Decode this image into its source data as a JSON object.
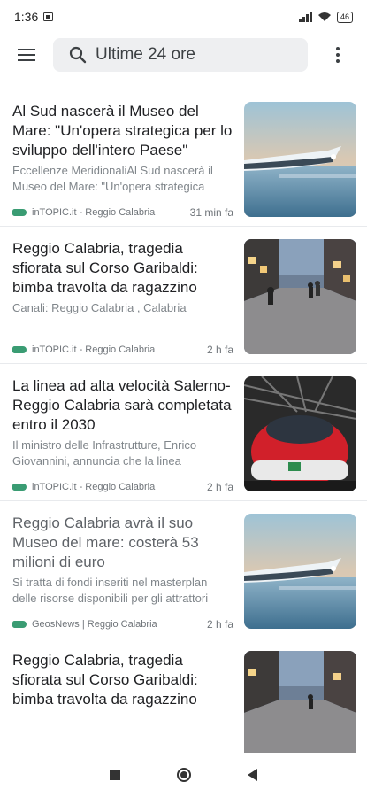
{
  "status": {
    "time": "1:36",
    "battery": "46",
    "sim_icon": "sim-card-icon",
    "signal_icon": "signal-icon",
    "wifi_icon": "wifi-icon"
  },
  "header": {
    "search_text": "Ultime 24 ore",
    "search_icon": "search-icon",
    "menu_icon": "hamburger-menu-icon",
    "more_icon": "more-vert-icon"
  },
  "articles": [
    {
      "title": "Al Sud nascerà il Museo del Mare: \"Un'opera strategica per lo sviluppo dell'intero Paese\"",
      "snippet": "Eccellenze MeridionaliAl Sud nascerà il Museo del Mare: \"Un'opera strategica",
      "source": "inTOPIC.it - Reggio Calabria",
      "time": "31 min fa",
      "image": "museo-del-mare-render"
    },
    {
      "title": "Reggio Calabria, tragedia sfiorata sul Corso Garibaldi: bimba travolta da ragazzino",
      "snippet": "Canali: Reggio Calabria , Calabria",
      "source": "inTOPIC.it - Reggio Calabria",
      "time": "2 h fa",
      "image": "corso-garibaldi-street"
    },
    {
      "title": "La linea ad alta velocità Salerno-Reggio Calabria sarà completata entro il 2030",
      "snippet": "Il ministro delle Infrastrutture, Enrico Giovannini, annuncia che la linea",
      "source": "inTOPIC.it - Reggio Calabria",
      "time": "2 h fa",
      "image": "frecciarossa-train"
    },
    {
      "title": "Reggio Calabria avrà il suo Museo del mare: costerà 53 milioni di euro",
      "snippet": "Si tratta di fondi inseriti nel masterplan delle risorse disponibili per gli attrattori",
      "source": "GeosNews | Reggio Calabria",
      "time": "2 h fa",
      "image": "museo-del-mare-render"
    },
    {
      "title": "Reggio Calabria, tragedia sfiorata sul Corso Garibaldi: bimba travolta da ragazzino",
      "snippet": "",
      "source": "",
      "time": "",
      "image": "corso-garibaldi-street"
    }
  ],
  "navigation": {
    "recents_icon": "square-icon",
    "home_icon": "home-circle-icon",
    "back_icon": "back-triangle-icon"
  }
}
